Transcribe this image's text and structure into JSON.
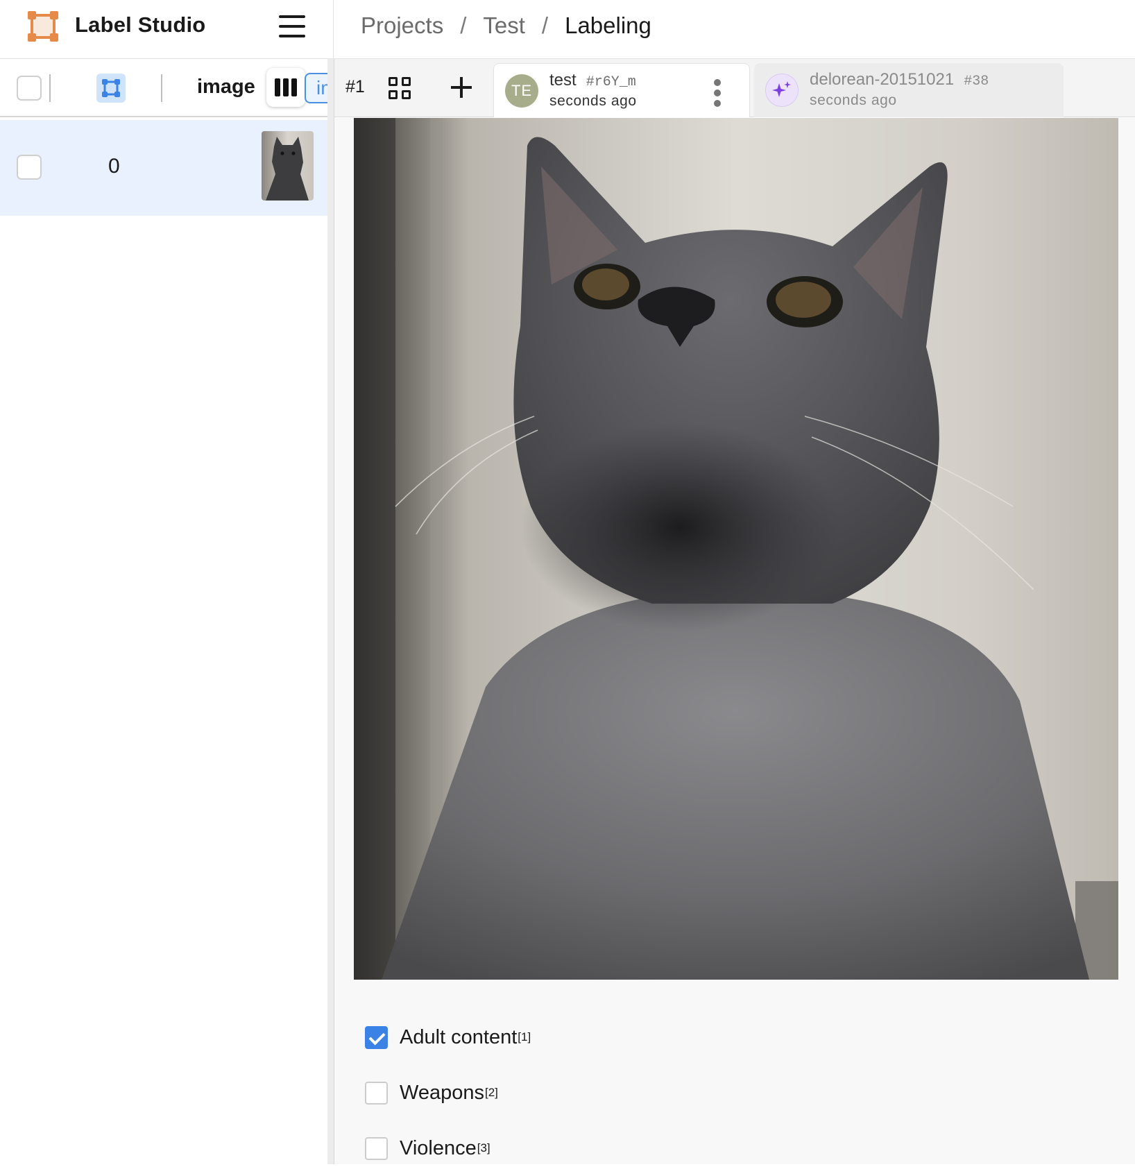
{
  "app": {
    "name": "Label Studio",
    "accent": "#e68a4a"
  },
  "breadcrumb": {
    "projects": "Projects",
    "project": "Test",
    "current": "Labeling",
    "separator": "/"
  },
  "data_manager": {
    "columns": {
      "image_header": "image",
      "tab_peek": "im"
    },
    "rows": [
      {
        "id": "0",
        "selected": false
      }
    ],
    "highlight_color": "#e8f1fd"
  },
  "annotation_bar": {
    "task_number": "#1",
    "annotations": [
      {
        "initials": "TE",
        "user": "test",
        "id": "#r6Y_m",
        "time": "seconds ago",
        "active": true
      },
      {
        "initials": "",
        "user": "delorean-20151021",
        "id": "#38",
        "time": "seconds ago",
        "active": false,
        "icon": "sparkles-icon"
      }
    ]
  },
  "choices": [
    {
      "label": "Adult content",
      "hotkey": "[1]",
      "checked": true
    },
    {
      "label": "Weapons",
      "hotkey": "[2]",
      "checked": false
    },
    {
      "label": "Violence",
      "hotkey": "[3]",
      "checked": false
    }
  ],
  "colors": {
    "checkbox_checked": "#3b82e6",
    "avatar_bg": "#a7ad8b",
    "ai_icon": "#7b3fe4"
  }
}
